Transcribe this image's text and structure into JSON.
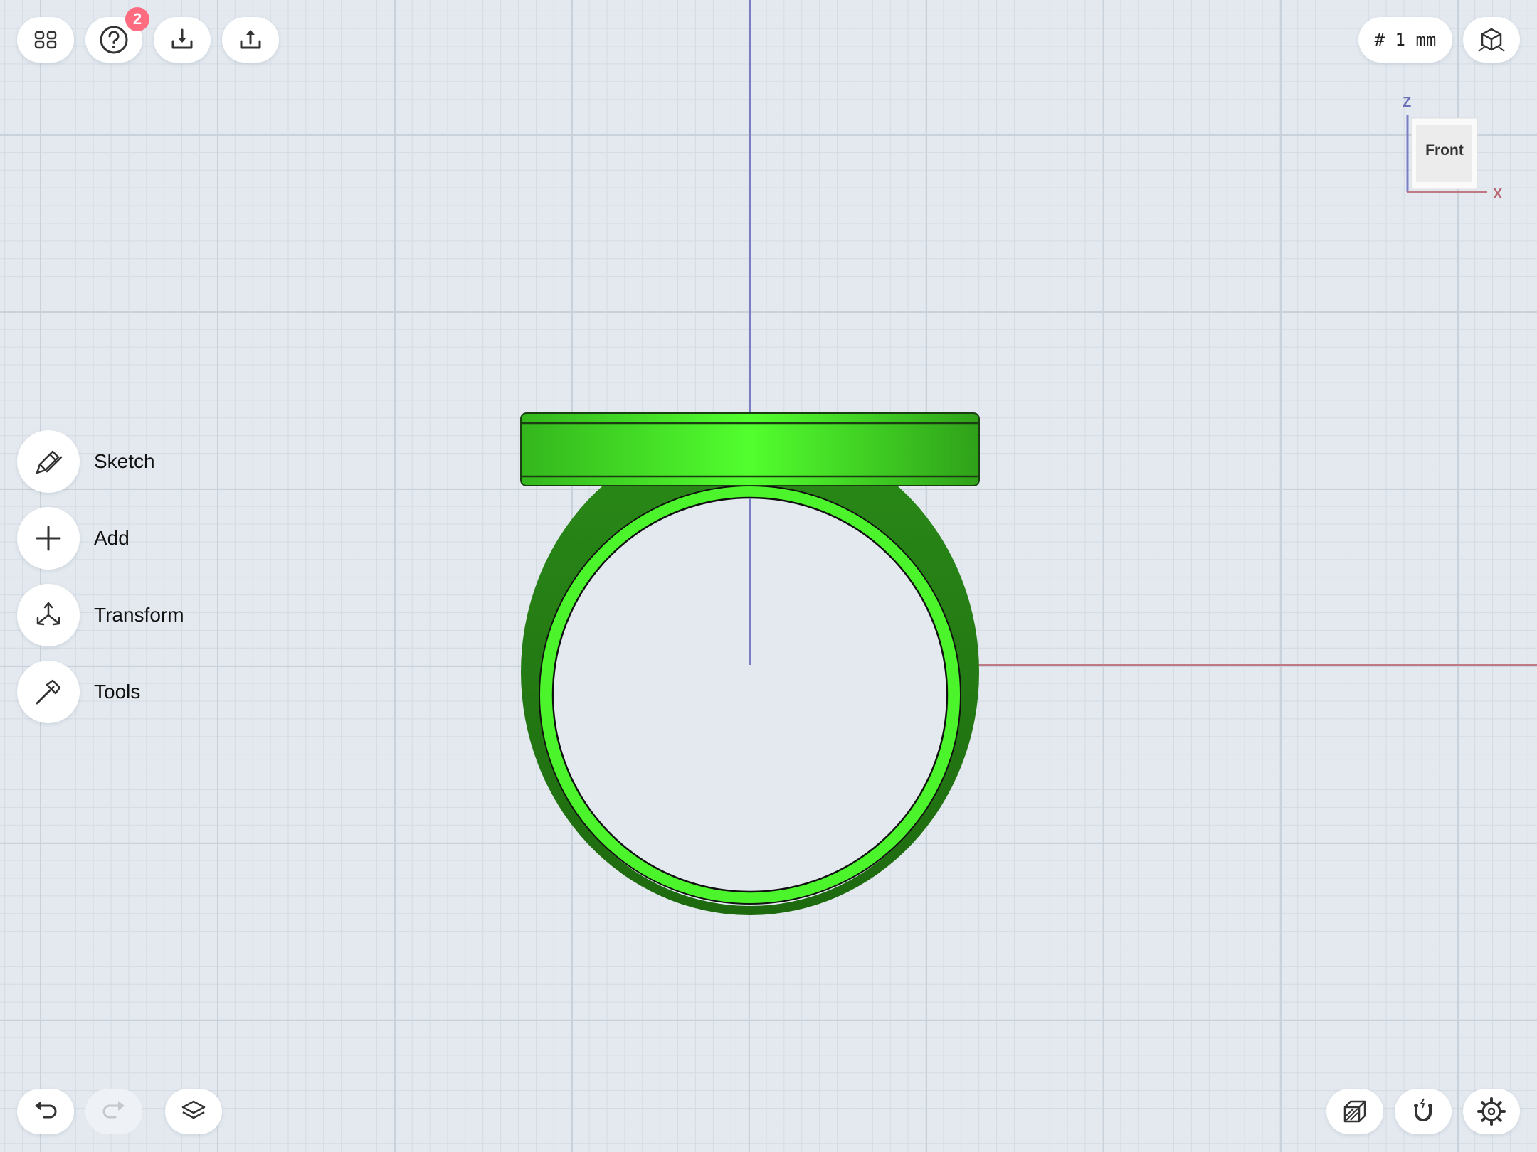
{
  "toolbar_top": {
    "help_badge": "2",
    "grid_size": "# 1 mm"
  },
  "view_cube": {
    "face": "Front",
    "axis_z": "Z",
    "axis_x": "X"
  },
  "side_menu": {
    "items": [
      {
        "label": "Sketch",
        "icon": "pen-icon"
      },
      {
        "label": "Add",
        "icon": "plus-icon"
      },
      {
        "label": "Transform",
        "icon": "transform-arrows-icon"
      },
      {
        "label": "Tools",
        "icon": "hammer-icon"
      }
    ]
  },
  "model": {
    "color": "#4cf52b",
    "shadow_color": "#1e7a10"
  },
  "axes": {
    "x_color": "#c07a85",
    "z_color": "#7a7fc4"
  }
}
